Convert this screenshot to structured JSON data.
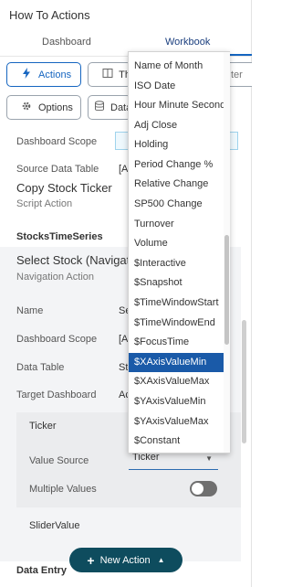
{
  "app": {
    "title": "How To Actions"
  },
  "tabs": [
    {
      "label": "Dashboard"
    },
    {
      "label": "Workbook",
      "active": true
    }
  ],
  "toolbar": {
    "actions_label": "Actions",
    "themes_label": "Th",
    "filter_label": "ter",
    "options_label": "Options",
    "data_label": "Data"
  },
  "top_section": {
    "scope_label": "Dashboard Scope",
    "source_table_label": "Source Data Table",
    "source_table_value": "[A"
  },
  "script_action": {
    "title": "Copy Stock Ticker",
    "subtitle": "Script Action"
  },
  "group_heading": "StocksTimeSeries",
  "nav_action": {
    "title": "Select Stock (Navigatio",
    "subtitle": "Navigation Action",
    "name_label": "Name",
    "name_value": "Se",
    "scope_label": "Dashboard Scope",
    "scope_value": "[A",
    "table_label": "Data Table",
    "table_value": "St",
    "target_label": "Target Dashboard",
    "target_value": "Ac"
  },
  "ticker_card": {
    "title": "Ticker",
    "value_source_label": "Value Source",
    "value_source_value": "Ticker",
    "multiple_values_label": "Multiple Values",
    "multiple_values_on": false
  },
  "slider_value_label": "SliderValue",
  "data_entry_heading": "Data Entry",
  "new_action_label": "New Action",
  "dropdown": {
    "selected": "$XAxisValueMin",
    "items": [
      "Name of Month",
      "ISO Date",
      "Hour Minute Second",
      "Adj Close",
      "Holding",
      "Period Change %",
      "Relative Change",
      "SP500 Change",
      "Turnover",
      "Volume",
      "$Interactive",
      "$Snapshot",
      "$TimeWindowStart",
      "$TimeWindowEnd",
      "$FocusTime",
      "$XAxisValueMin",
      "$XAxisValueMax",
      "$YAxisValueMin",
      "$YAxisValueMax",
      "$Constant"
    ]
  },
  "colors": {
    "accent": "#1565c0",
    "selected_item": "#1a5aa8",
    "new_action_button": "#0e4c5e"
  }
}
